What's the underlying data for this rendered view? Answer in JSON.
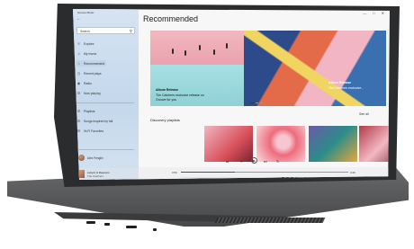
{
  "app": {
    "window_title": "Groove Music",
    "search_label": "Search",
    "nav": [
      {
        "label": "Explore",
        "icon": "compass-icon"
      },
      {
        "label": "My music",
        "icon": "music-note-icon"
      },
      {
        "label": "Recommended",
        "icon": "star-icon"
      },
      {
        "label": "Recent plays",
        "icon": "clock-icon"
      },
      {
        "label": "Radio",
        "icon": "radio-icon"
      },
      {
        "label": "Now playing",
        "icon": "bars-icon"
      }
    ],
    "playlists_header": "Playlists",
    "playlists": [
      {
        "label": "Songs inspired by fall",
        "icon": "playlist-icon"
      },
      {
        "label": "Hi-Fi Favorites",
        "icon": "playlist-icon"
      }
    ],
    "user_name": "Alex Fenglin",
    "now_playing": {
      "title": "Letters & Reasons",
      "artist": "The Catchers"
    }
  },
  "main": {
    "title": "Recommended",
    "hero": {
      "badge": "Album Release",
      "text": "The Catchers exclusive release on",
      "text2": "Groove for you",
      "right_badge": "Album Release",
      "right_text": "The Catchers exclusive..."
    },
    "section_title": "Discovery playlists",
    "see_all": "See all",
    "player": {
      "elapsed": "0:53",
      "remaining": "3:26",
      "progress": 0.32
    }
  },
  "colors": {
    "accent": "#0067c0",
    "sidebar": "#c9dbec",
    "chassis": "#58595b"
  }
}
